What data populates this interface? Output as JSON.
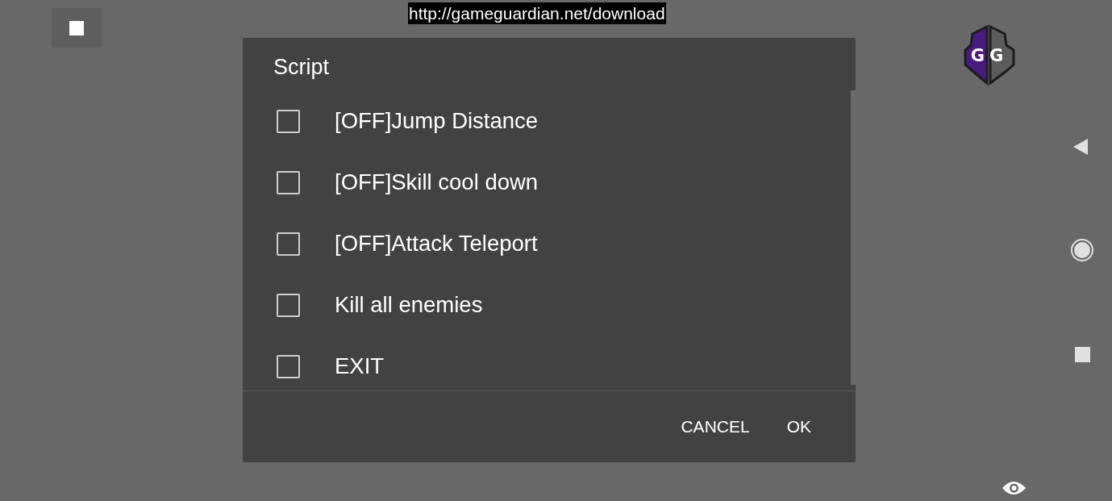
{
  "url_banner": "http://gameguardian.net/download",
  "logo": {
    "text": "GG"
  },
  "dialog": {
    "title": "Script",
    "options": [
      {
        "label": "[OFF]Jump Distance",
        "checked": false
      },
      {
        "label": "[OFF]Skill cool down",
        "checked": false
      },
      {
        "label": "[OFF]Attack Teleport",
        "checked": false
      },
      {
        "label": "Kill all enemies",
        "checked": false
      },
      {
        "label": "EXIT",
        "checked": false
      }
    ],
    "buttons": [
      "CANCEL",
      "OK"
    ]
  }
}
